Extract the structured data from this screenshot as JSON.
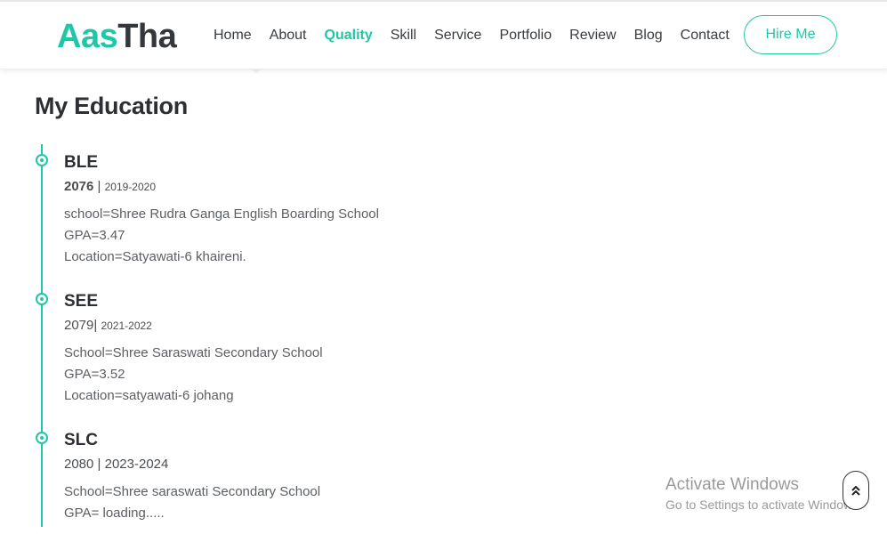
{
  "logo": {
    "part1": "Aas",
    "part2": "Tha"
  },
  "nav": {
    "items": [
      "Home",
      "About",
      "Quality",
      "Skill",
      "Service",
      "Portfolio",
      "Review",
      "Blog",
      "Contact"
    ],
    "active": "Quality",
    "hire_label": "Hire Me"
  },
  "section": {
    "title": "My Education"
  },
  "education": [
    {
      "title": "BLE",
      "year_main": "2076",
      "year_sep": " | ",
      "year_sub": "2019-2020",
      "lines": [
        "school=Shree Rudra Ganga English Boarding School",
        "GPA=3.47",
        "Location=Satyawati-6 khaireni."
      ]
    },
    {
      "title": "SEE",
      "year_main": "2079",
      "year_sep": "| ",
      "year_sub": "2021-2022",
      "lines": [
        "School=Shree Saraswati Secondary School",
        "GPA=3.52",
        "Location=satyawati-6 johang"
      ]
    },
    {
      "title": "SLC",
      "year_main": "2080",
      "year_sep": " | ",
      "year_sub": "2023-2024",
      "lines": [
        "School=Shree saraswati Secondary School",
        "GPA= loading....."
      ]
    }
  ],
  "watermark": {
    "title": "Activate Windows",
    "subtitle": "Go to Settings to activate Windows."
  },
  "scroll_top": {
    "icon": "double-chevron-up-icon",
    "glyph": "«"
  },
  "colors": {
    "accent": "#1fc7a6",
    "text": "#2c2f33"
  }
}
